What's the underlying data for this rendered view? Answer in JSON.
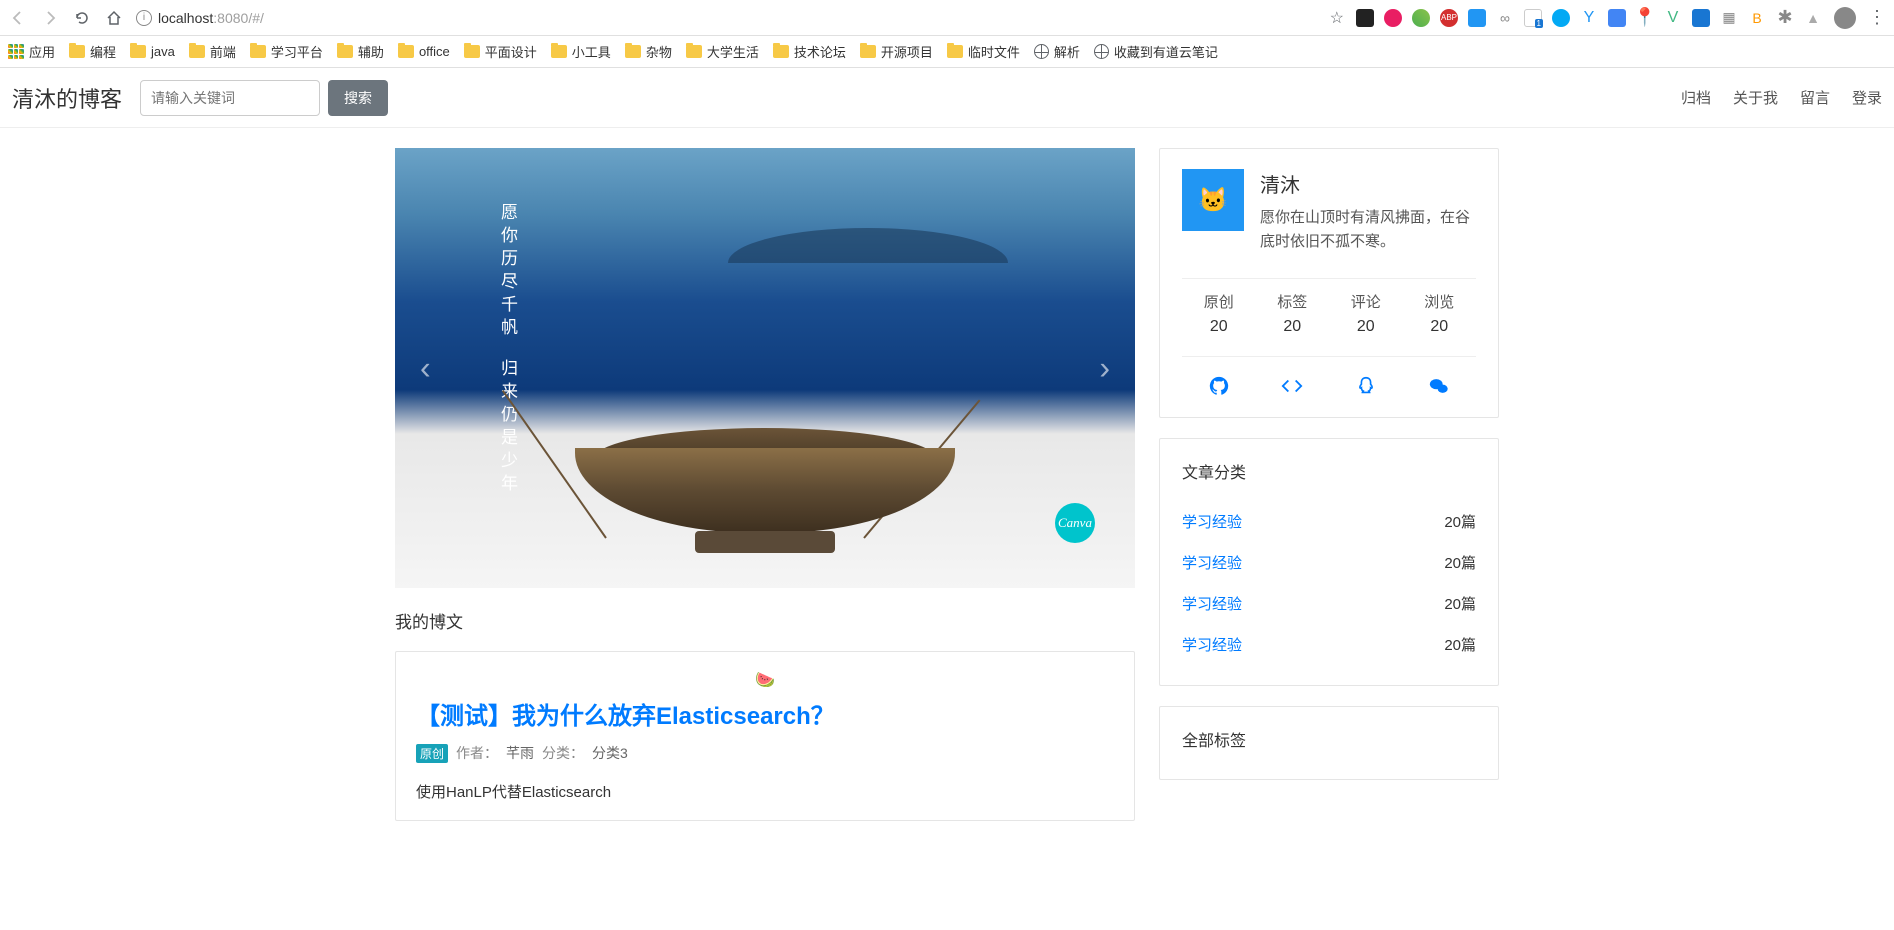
{
  "browser": {
    "url_prefix": "localhost",
    "url_port": ":8080",
    "url_path": "/#/",
    "apps_label": "应用",
    "bookmarks": [
      "编程",
      "java",
      "前端",
      "学习平台",
      "辅助",
      "office",
      "平面设计",
      "小工具",
      "杂物",
      "大学生活",
      "技术论坛",
      "开源项目",
      "临时文件"
    ],
    "globe_bookmarks": [
      "解析",
      "收藏到有道云笔记"
    ]
  },
  "header": {
    "title": "清沐的博客",
    "search_placeholder": "请输入关键词",
    "search_btn": "搜索",
    "nav": [
      "归档",
      "关于我",
      "留言",
      "登录"
    ]
  },
  "hero": {
    "line1": "愿你历尽千帆",
    "line2": "归来仍是少年",
    "canva": "Canva"
  },
  "posts": {
    "section_title": "我的博文",
    "items": [
      {
        "title": "【测试】我为什么放弃Elasticsearch？",
        "badge": "原创",
        "author_label": "作者：",
        "author": "芊雨",
        "cat_label": "分类：",
        "category": "分类3",
        "excerpt": "使用HanLP代替Elasticsearch",
        "decor": "🍉"
      }
    ]
  },
  "profile": {
    "name": "清沐",
    "bio": "愿你在山顶时有清风拂面，在谷底时依旧不孤不寒。",
    "avatar_emoji": "🐱",
    "stats": [
      {
        "label": "原创",
        "value": "20"
      },
      {
        "label": "标签",
        "value": "20"
      },
      {
        "label": "评论",
        "value": "20"
      },
      {
        "label": "浏览",
        "value": "20"
      }
    ]
  },
  "categories": {
    "title": "文章分类",
    "items": [
      {
        "name": "学习经验",
        "count": "20篇"
      },
      {
        "name": "学习经验",
        "count": "20篇"
      },
      {
        "name": "学习经验",
        "count": "20篇"
      },
      {
        "name": "学习经验",
        "count": "20篇"
      }
    ]
  },
  "tags": {
    "title": "全部标签"
  }
}
